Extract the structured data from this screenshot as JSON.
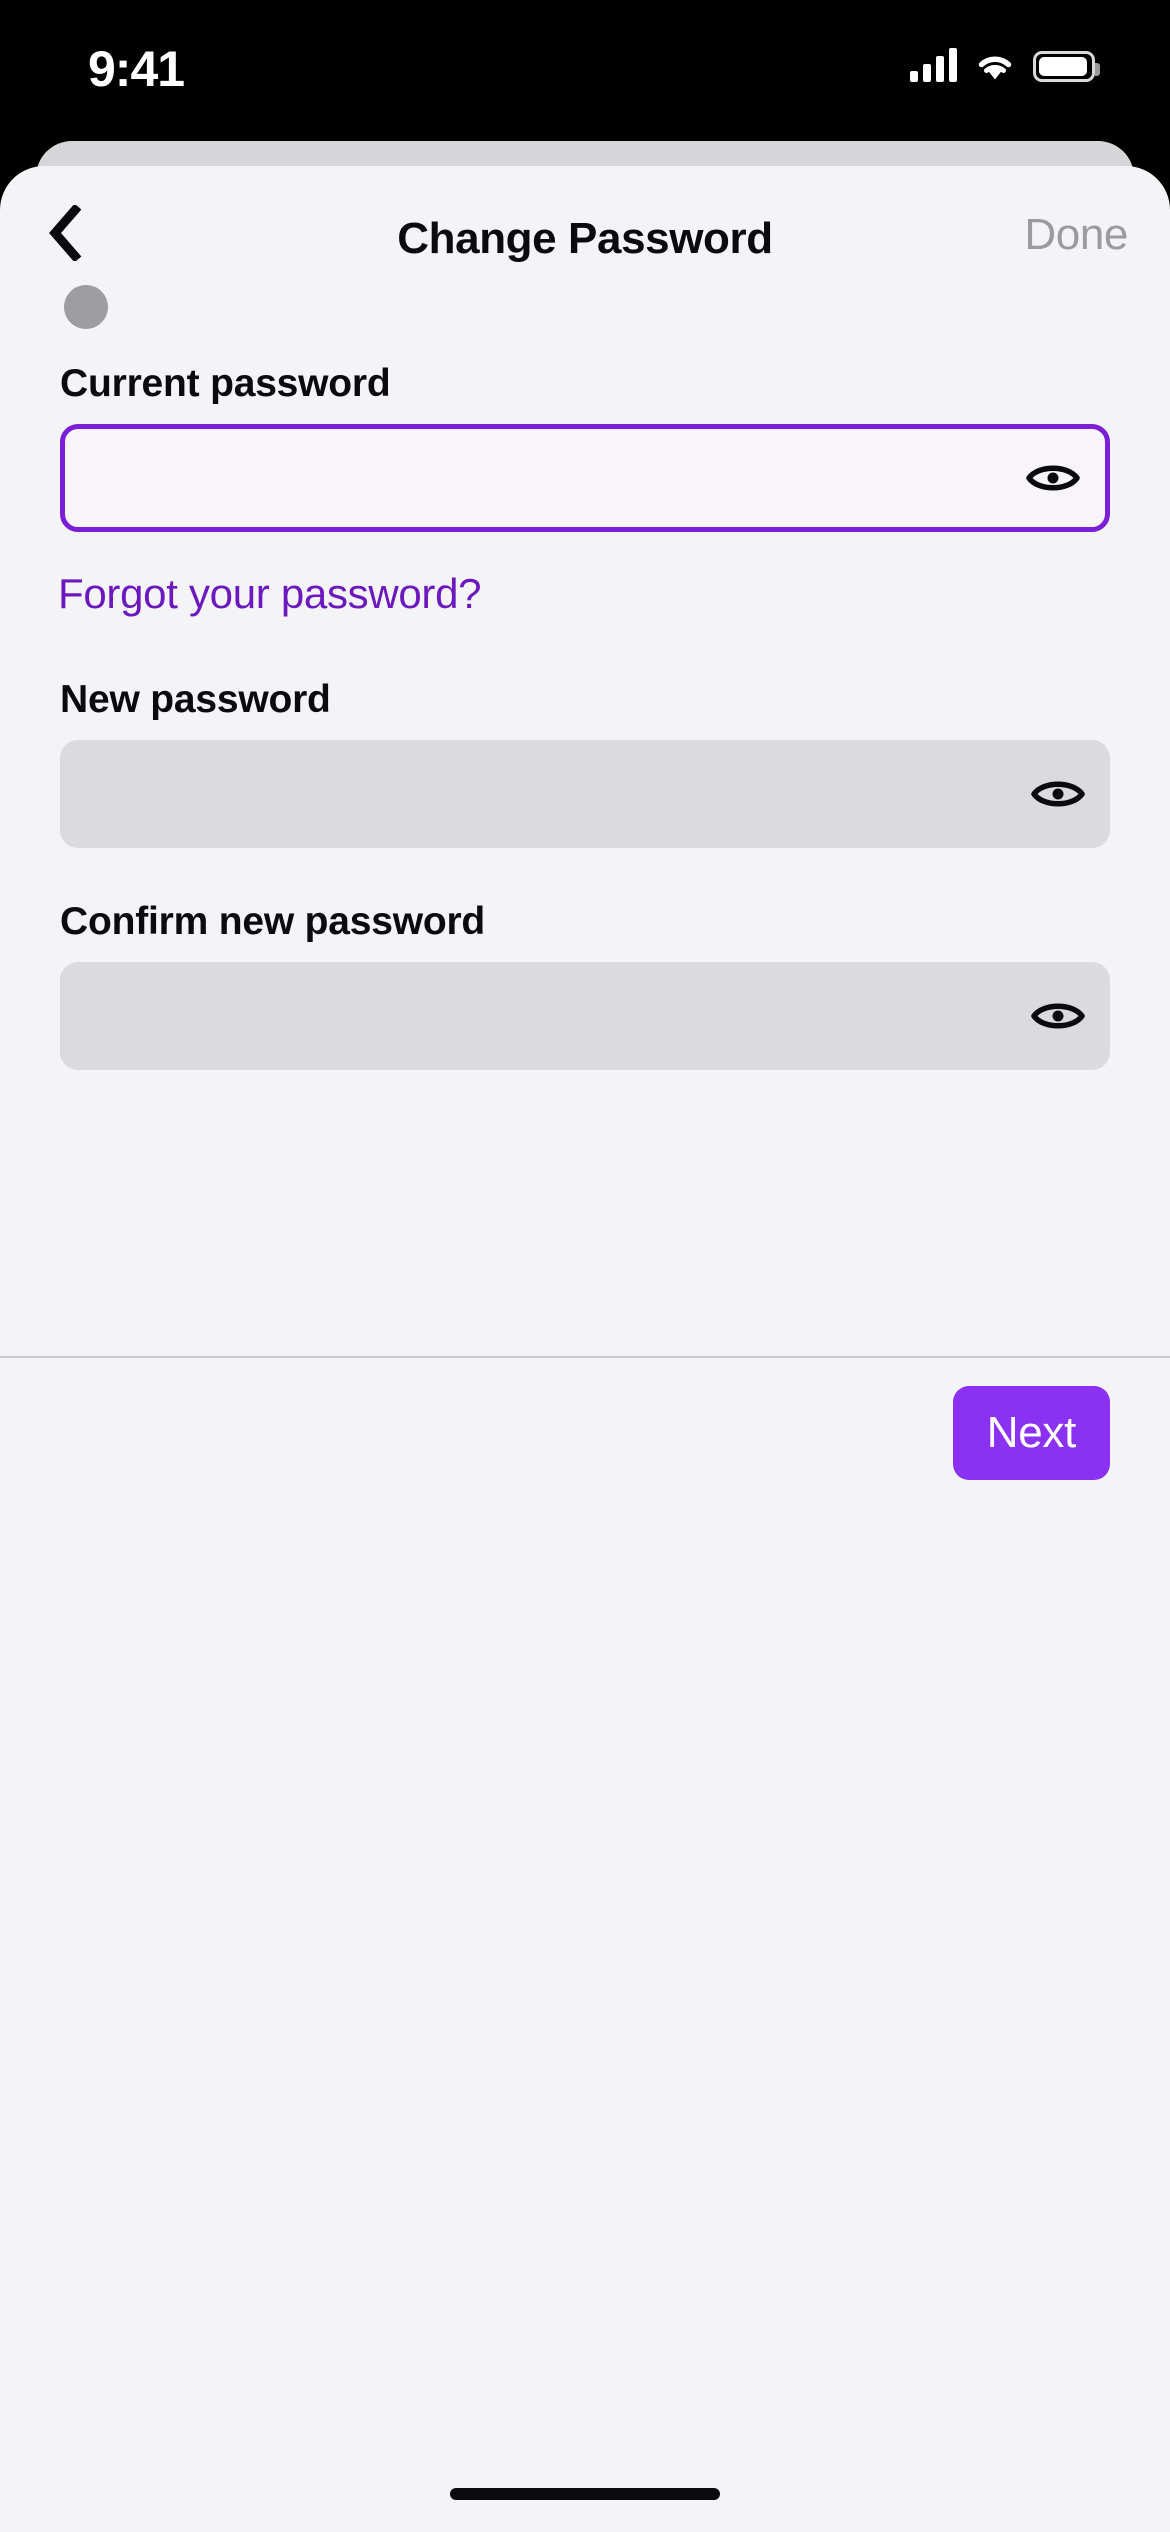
{
  "status_bar": {
    "time": "9:41",
    "cellular_icon": "cellular-signal-icon",
    "wifi_icon": "wifi-icon",
    "battery_icon": "battery-icon"
  },
  "header": {
    "back_icon": "chevron-left-icon",
    "title": "Change Password",
    "done_label": "Done",
    "avatar": "avatar-circle"
  },
  "colors": {
    "accent_purple": "#8B32F2",
    "focus_border": "#7A1FD6",
    "link_purple": "#6B19BE",
    "field_fill": "#DBDBDD",
    "sheet_background": "#F4F4F7",
    "sheet_behind": "#D6D6D8",
    "done_gray": "#9A9AA0"
  },
  "form": {
    "fields": [
      {
        "label": "Current password",
        "value": "",
        "placeholder": "",
        "state": "focused",
        "reveal_icon": "eye-icon"
      },
      {
        "label": "New password",
        "value": "",
        "placeholder": "",
        "state": "default",
        "reveal_icon": "eye-icon"
      },
      {
        "label": "Confirm new password",
        "value": "",
        "placeholder": "",
        "state": "default",
        "reveal_icon": "eye-icon"
      }
    ],
    "forgot_link": "Forgot your password?"
  },
  "footer": {
    "next_label": "Next"
  }
}
